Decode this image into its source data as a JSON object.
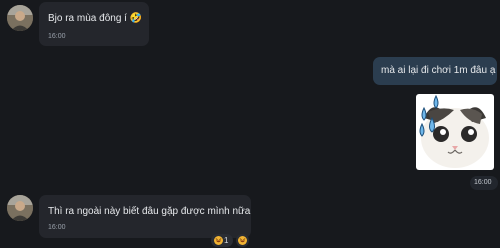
{
  "messages": [
    {
      "direction": "incoming",
      "text": "Bjo ra mùa đông í 🤣",
      "time": "16:00"
    },
    {
      "direction": "outgoing",
      "text": "mà ai lại đi chơi 1m đâu ạ"
    },
    {
      "direction": "outgoing",
      "type": "sticker",
      "sticker": "crying-cat-sticker",
      "time": "16:00"
    },
    {
      "direction": "incoming",
      "text": "Thì ra ngoài này biết đâu gặp được mình nữa",
      "time": "16:00",
      "reactions": [
        {
          "emoji": "laughing-emoji",
          "count": "1"
        },
        {
          "emoji": "laughing-emoji",
          "count": ""
        }
      ]
    }
  ],
  "colors": {
    "background": "#17191d",
    "incoming_bubble": "#24262c",
    "outgoing_bubble": "#2b3d4f",
    "time_text": "#9aa1ab"
  }
}
